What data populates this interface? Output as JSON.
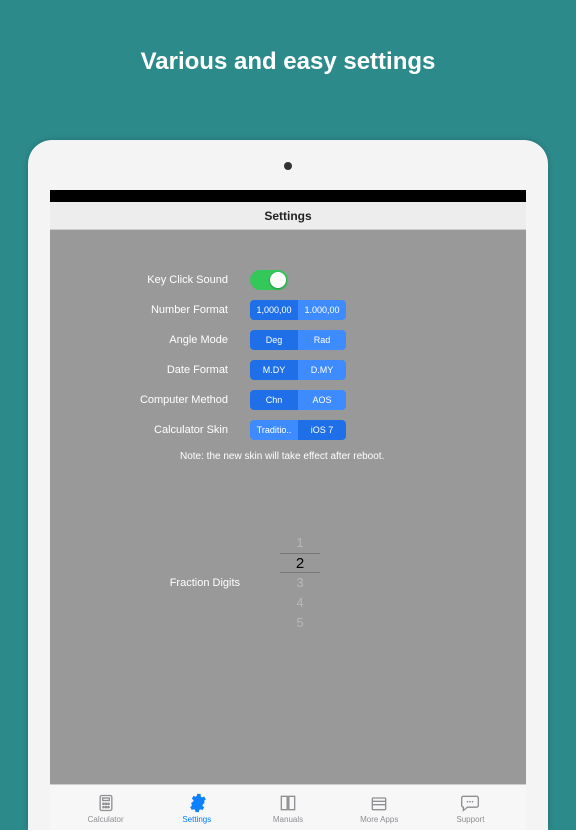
{
  "banner": {
    "title": "Various and easy settings"
  },
  "navbar": {
    "title": "Settings"
  },
  "settings": {
    "key_click": {
      "label": "Key Click Sound",
      "on": true
    },
    "number_format": {
      "label": "Number Format",
      "opt1": "1,000,00",
      "opt2": "1.000,00",
      "selected": 0
    },
    "angle_mode": {
      "label": "Angle Mode",
      "opt1": "Deg",
      "opt2": "Rad",
      "selected": 0
    },
    "date_format": {
      "label": "Date Format",
      "opt1": "M.DY",
      "opt2": "D.MY",
      "selected": 0
    },
    "computer_method": {
      "label": "Computer Method",
      "opt1": "Chn",
      "opt2": "AOS",
      "selected": 0
    },
    "calc_skin": {
      "label": "Calculator Skin",
      "opt1": "Traditio..",
      "opt2": "iOS 7",
      "selected": 1
    },
    "note": "Note:  the new skin will take effect after reboot.",
    "fraction_digits": {
      "label": "Fraction Digits",
      "values": [
        "1",
        "2",
        "3",
        "4",
        "5"
      ],
      "selected_index": 1
    }
  },
  "tabs": {
    "items": [
      {
        "label": "Calculator"
      },
      {
        "label": "Settings"
      },
      {
        "label": "Manuals"
      },
      {
        "label": "More Apps"
      },
      {
        "label": "Support"
      }
    ],
    "active_index": 1
  }
}
